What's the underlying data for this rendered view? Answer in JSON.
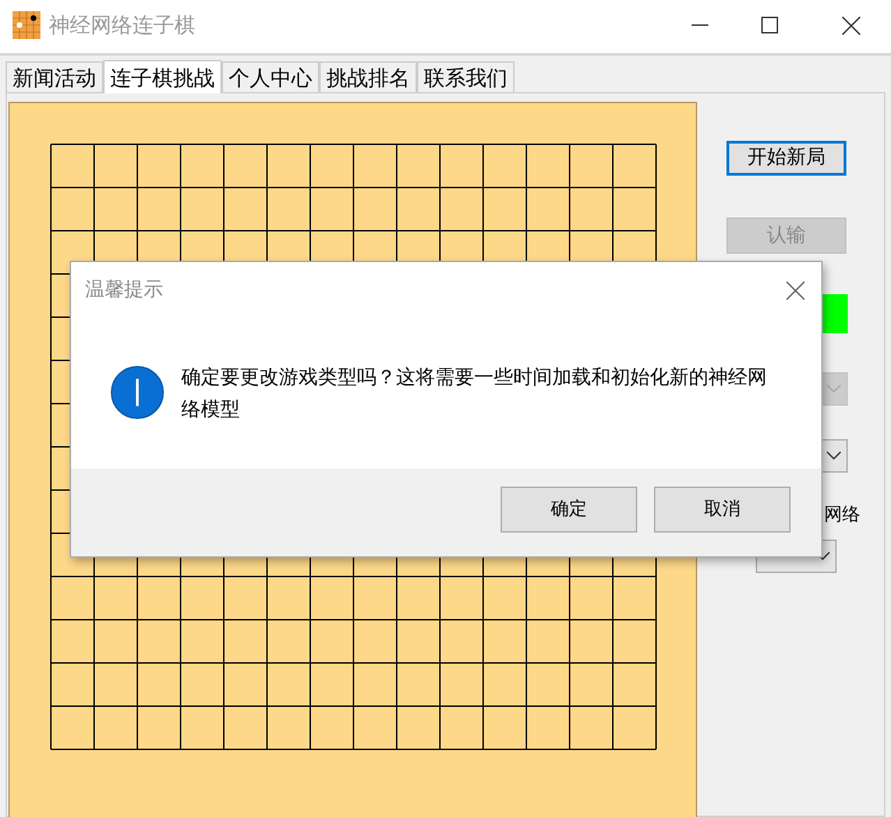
{
  "window": {
    "title": "神经网络连子棋"
  },
  "tabs": [
    {
      "label": "新闻活动",
      "selected": false
    },
    {
      "label": "连子棋挑战",
      "selected": true
    },
    {
      "label": "个人中心",
      "selected": false
    },
    {
      "label": "挑战排名",
      "selected": false
    },
    {
      "label": "联系我们",
      "selected": false
    }
  ],
  "side_panel": {
    "new_game_button": {
      "label": "开始新局",
      "disabled": false
    },
    "resign_button": {
      "label": "认输",
      "disabled": true
    },
    "network_label": "网络",
    "dropdowns": [
      {
        "disabled": true
      },
      {
        "disabled": false
      },
      {
        "disabled": false
      }
    ]
  },
  "dialog": {
    "title": "温馨提示",
    "message": "确定要更改游戏类型吗？这将需要一些时间加载和初始化新的神经网络模型",
    "buttons": [
      "确定",
      "取消"
    ]
  }
}
